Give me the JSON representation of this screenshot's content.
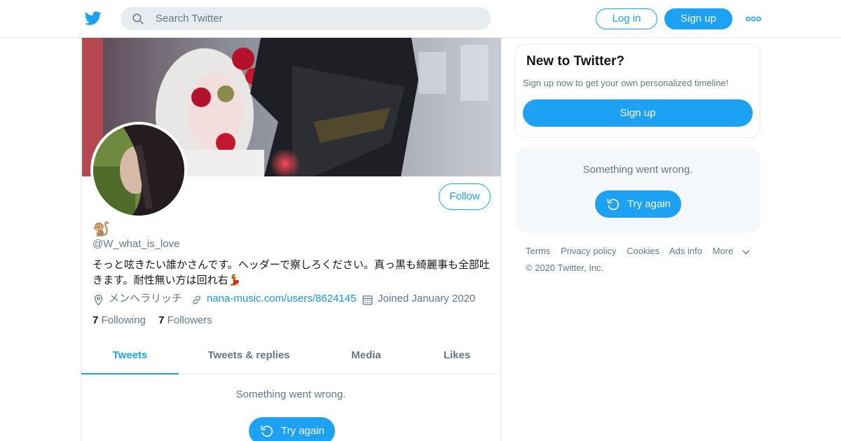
{
  "header": {
    "logo_icon": "twitter-bird-icon",
    "search_placeholder": "Search Twitter",
    "search_value": "",
    "login_label": "Log in",
    "signup_label": "Sign up",
    "more_icon": "more-dots-icon"
  },
  "profile": {
    "display_name": "🐒",
    "handle": "@W_what_is_love",
    "bio": "そっと呟きたい誰かさんです。ヘッダーで察しろください。真っ黒も綺麗事も全部吐きます。耐性無い方は回れ右💃",
    "follow_label": "Follow",
    "location": "メンヘラリッチ",
    "website": "nana-music.com/users/8624145",
    "joined": "Joined January 2020",
    "following_count": "7",
    "following_label": "Following",
    "followers_count": "7",
    "followers_label": "Followers"
  },
  "tabs": [
    {
      "label": "Tweets",
      "active": true
    },
    {
      "label": "Tweets & replies",
      "active": false
    },
    {
      "label": "Media",
      "active": false
    },
    {
      "label": "Likes",
      "active": false
    }
  ],
  "timeline": {
    "error_message": "Something went wrong.",
    "retry_label": "Try again"
  },
  "sidebar": {
    "new_title": "New to Twitter?",
    "new_text": "Sign up now to get your own personalized timeline!",
    "signup_label": "Sign up",
    "error_message": "Something went wrong.",
    "retry_label": "Try again"
  },
  "footer": {
    "links": [
      "Terms",
      "Privacy policy",
      "Cookies",
      "Ads info",
      "More"
    ],
    "copyright": "© 2020 Twitter, Inc."
  },
  "colors": {
    "accent": "#1da1f2",
    "secondary_text": "#657786",
    "border": "#e6ecf0"
  }
}
